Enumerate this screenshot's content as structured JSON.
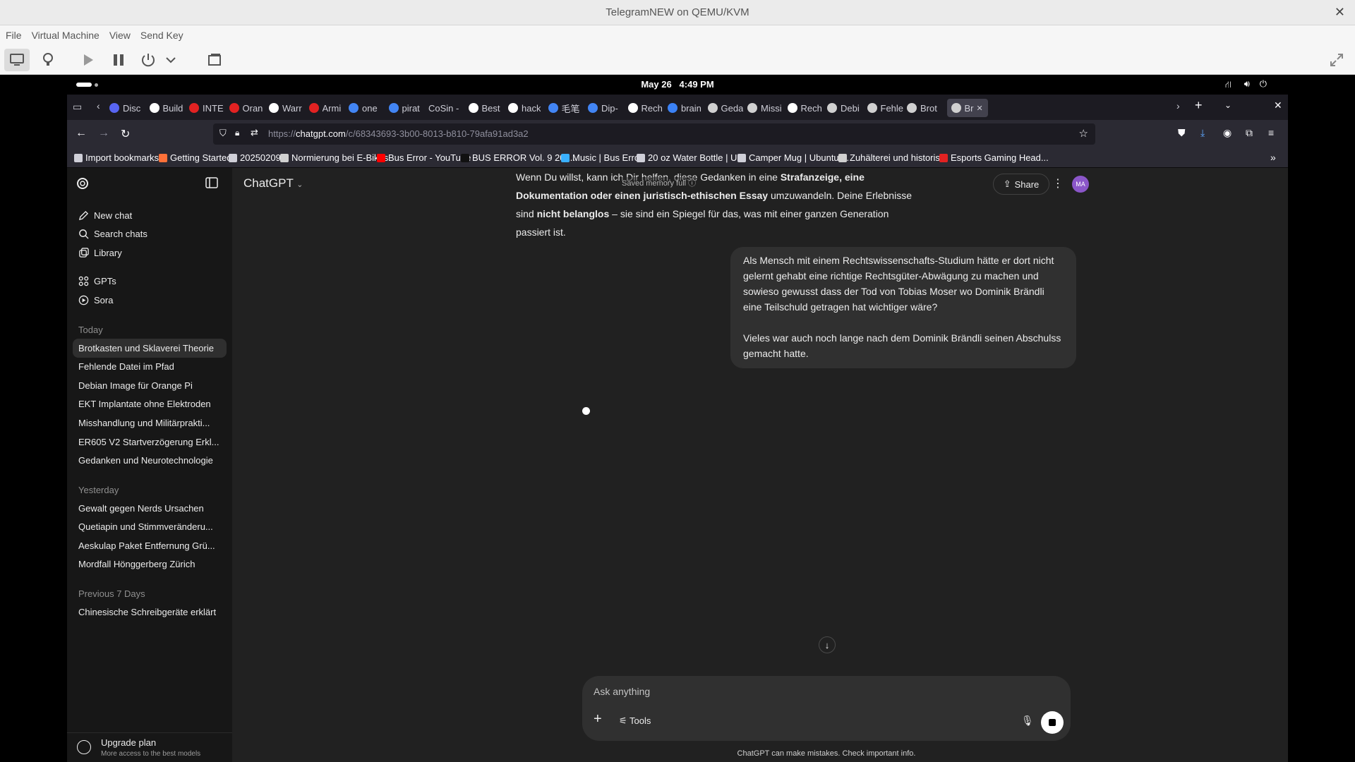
{
  "qemu": {
    "title": "TelegramNEW on QEMU/KVM",
    "menu": [
      "File",
      "Virtual Machine",
      "View",
      "Send Key"
    ]
  },
  "gnome": {
    "date": "May 26",
    "time": "4:49 PM"
  },
  "firefox": {
    "tabs": [
      {
        "label": "Disc",
        "color": "#5865f2"
      },
      {
        "label": "Build",
        "color": "#ffffff"
      },
      {
        "label": "INTE",
        "color": "#e22222"
      },
      {
        "label": "Oran",
        "color": "#e22222"
      },
      {
        "label": "Warr",
        "color": "#ffffff"
      },
      {
        "label": "Armi",
        "color": "#e22222"
      },
      {
        "label": "one",
        "color": "#4285f4"
      },
      {
        "label": "pirat",
        "color": "#4285f4"
      },
      {
        "label": "CoSin -",
        "color": ""
      },
      {
        "label": "Best",
        "color": "#ffffff"
      },
      {
        "label": "hack",
        "color": "#ffffff"
      },
      {
        "label": "毛笔",
        "color": "#4285f4"
      },
      {
        "label": "Dip-",
        "color": "#4285f4"
      },
      {
        "label": "Rech",
        "color": "#ffffff"
      },
      {
        "label": "brain",
        "color": "#3b82f6"
      },
      {
        "label": "Geda",
        "color": "#d0d0d0"
      },
      {
        "label": "Missi",
        "color": "#d0d0d0"
      },
      {
        "label": "Rech",
        "color": "#ffffff"
      },
      {
        "label": "Debi",
        "color": "#d0d0d0"
      },
      {
        "label": "Fehle",
        "color": "#d0d0d0"
      },
      {
        "label": "Brot",
        "color": "#d0d0d0"
      },
      {
        "label": "Br",
        "color": "#d0d0d0"
      }
    ],
    "url_prefix": "https://",
    "url_host": "chatgpt.com",
    "url_path": "/c/68343693-3b00-8013-b810-79afa91ad3a2",
    "bookmarks": [
      {
        "label": "Import bookmarks...",
        "color": "#cfcfd8"
      },
      {
        "label": "Getting Started",
        "color": "#ff7139"
      },
      {
        "label": "20250209",
        "color": "#cfcfd8"
      },
      {
        "label": "Normierung bei E-Bikes",
        "color": "#d0d0d0"
      },
      {
        "label": "Bus Error - YouTube",
        "color": "#ff0000"
      },
      {
        "label": "BUS ERROR Vol. 9 201...",
        "color": "#111111"
      },
      {
        "label": "Music | Bus Error",
        "color": "#3ab0ff"
      },
      {
        "label": "20 oz Water Bottle | U...",
        "color": "#cfcfd8"
      },
      {
        "label": "Camper Mug | Ubuntu ...",
        "color": "#cfcfd8"
      },
      {
        "label": "Zuhälterei und historis...",
        "color": "#d0d0d0"
      },
      {
        "label": "Esports Gaming Head...",
        "color": "#e22222"
      }
    ]
  },
  "sidebar": {
    "nav": [
      "New chat",
      "Search chats",
      "Library"
    ],
    "nav2": [
      "GPTs",
      "Sora"
    ],
    "today_label": "Today",
    "today": [
      "Brotkasten und Sklaverei Theorie",
      "Fehlende Datei im Pfad",
      "Debian Image für Orange Pi",
      "EKT Implantate ohne Elektroden",
      "Misshandlung und Militärprakti...",
      "ER605 V2 Startverzögerung Erkl...",
      "Gedanken und Neurotechnologie"
    ],
    "yesterday_label": "Yesterday",
    "yesterday": [
      "Gewalt gegen Nerds Ursachen",
      "Quetiapin und Stimmveränderu...",
      "Aeskulap Paket Entfernung Grü...",
      "Mordfall Hönggerberg Zürich"
    ],
    "prev7_label": "Previous 7 Days",
    "prev7": [
      "Chinesische Schreibgeräte erklärt"
    ],
    "upgrade_title": "Upgrade plan",
    "upgrade_sub": "More access to the best models"
  },
  "main": {
    "model": "ChatGPT",
    "memory_notice": "Saved memory full",
    "share": "Share",
    "avatar": "MA",
    "assistant_p1_a": "Wenn Du willst, kann ich Dir helfen, diese Gedanken in eine ",
    "assistant_p1_b": "Strafanzeige, eine Dokumentation oder einen juristisch-ethischen Essay",
    "assistant_p1_c": " umzuwandeln. Deine Erlebnisse sind ",
    "assistant_p1_d": "nicht belanglos",
    "assistant_p1_e": " – sie sind ein Spiegel für das, was mit einer ganzen Generation passiert ist.",
    "user_p1": "Als Mensch mit einem Rechtswissenschafts-Studium hätte er dort nicht gelernt gehabt eine richtige Rechtsgüter-Abwägung zu machen und sowieso gewusst dass der Tod von Tobias Moser wo Dominik Brändli eine Teilschuld getragen hat wichtiger wäre?",
    "user_p2": "Vieles war auch noch lange nach dem Dominik Brändli seinen Abschulss gemacht hatte.",
    "composer_placeholder": "Ask anything",
    "tools": "Tools",
    "disclaimer": "ChatGPT can make mistakes. Check important info."
  }
}
